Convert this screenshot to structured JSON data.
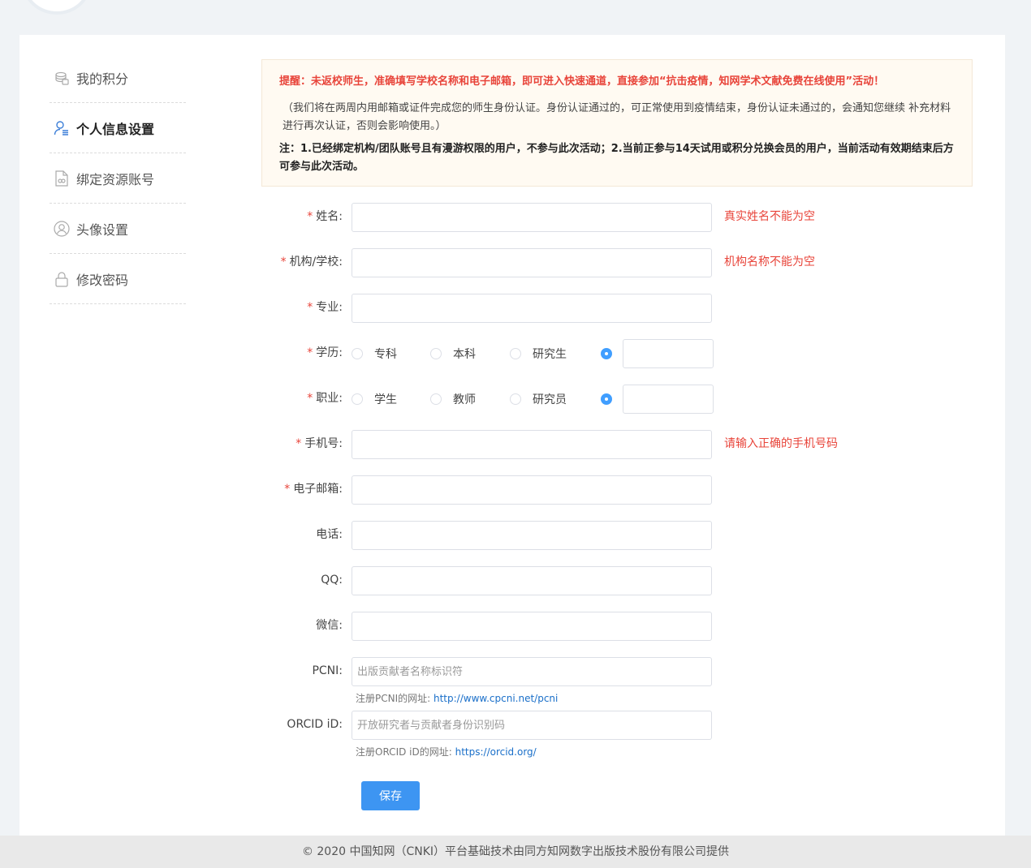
{
  "sidebar": {
    "items": [
      {
        "label": "我的积分",
        "icon": "coins-icon",
        "active": false
      },
      {
        "label": "个人信息设置",
        "icon": "user-icon",
        "active": true
      },
      {
        "label": "绑定资源账号",
        "icon": "link-doc-icon",
        "active": false
      },
      {
        "label": "头像设置",
        "icon": "avatar-icon",
        "active": false
      },
      {
        "label": "修改密码",
        "icon": "lock-icon",
        "active": false
      }
    ]
  },
  "notice": {
    "alert": "提醒：未返校师生，准确填写学校名称和电子邮箱，即可进入快速通道，直接参加“抗击疫情，知网学术文献免费在线使用”活动！",
    "info": "（我们将在两周内用邮箱或证件完成您的师生身份认证。身份认证通过的，可正常使用到疫情结束，身份认证未通过的，会通知您继续 补充材料进行再次认证，否则会影响使用。）",
    "note": "注：1.已经绑定机构/团队账号且有漫游权限的用户，不参与此次活动；2.当前正参与14天试用或积分兑换会员的用户，当前活动有效期结束后方可参与此次活动。"
  },
  "form": {
    "name": {
      "label": "姓名:",
      "value": "",
      "error": "真实姓名不能为空"
    },
    "org": {
      "label": "机构/学校:",
      "value": "",
      "error": "机构名称不能为空"
    },
    "major": {
      "label": "专业:",
      "value": ""
    },
    "education": {
      "label": "学历:",
      "options": [
        "专科",
        "本科",
        "研究生"
      ],
      "selected_other": true,
      "other_value": ""
    },
    "job": {
      "label": "职业:",
      "options": [
        "学生",
        "教师",
        "研究员"
      ],
      "selected_other": true,
      "other_value": ""
    },
    "phone": {
      "label": "手机号:",
      "value": "",
      "error": "请输入正确的手机号码"
    },
    "email": {
      "label": "电子邮箱:",
      "value": ""
    },
    "tel": {
      "label": "电话:",
      "value": ""
    },
    "qq": {
      "label": "QQ:",
      "value": ""
    },
    "wechat": {
      "label": "微信:",
      "value": ""
    },
    "pcni": {
      "label": "PCNI:",
      "placeholder": "出版贡献者名称标识符",
      "hint": "注册PCNI的网址: ",
      "hint_link": "http://www.cpcni.net/pcni"
    },
    "orcid": {
      "label": "ORCID iD:",
      "placeholder": "开放研究者与贡献者身份识别码",
      "hint": "注册ORCID iD的网址: ",
      "hint_link": "https://orcid.org/"
    },
    "required_mark": "*",
    "save_label": "保存"
  },
  "footer": {
    "text": "© 2020 中国知网（CNKI）平台基础技术由同方知网数字出版技术股份有限公司提供"
  },
  "colors": {
    "accent": "#3d95f2",
    "error": "#e8443a",
    "notice_bg": "#fffaf2"
  }
}
